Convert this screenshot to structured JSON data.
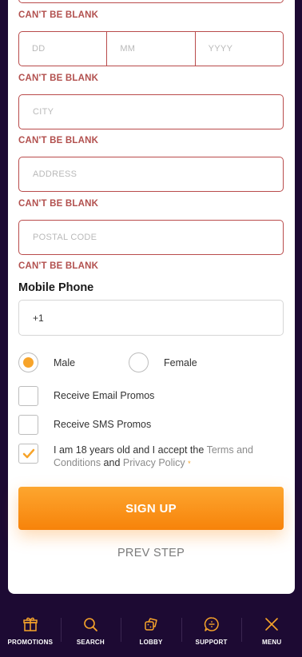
{
  "errors": {
    "cant_be_blank": "CAN'T BE BLANK"
  },
  "dob": {
    "day_placeholder": "DD",
    "month_placeholder": "MM",
    "year_placeholder": "YYYY"
  },
  "city": {
    "placeholder": "CITY"
  },
  "address": {
    "placeholder": "ADDRESS"
  },
  "postal": {
    "placeholder": "POSTAL CODE"
  },
  "mobile": {
    "label": "Mobile Phone",
    "value": "+1"
  },
  "gender": {
    "options": [
      {
        "label": "Male",
        "selected": true
      },
      {
        "label": "Female",
        "selected": false
      }
    ]
  },
  "promos": {
    "email_label": "Receive Email Promos",
    "email_checked": false,
    "sms_label": "Receive SMS Promos",
    "sms_checked": false
  },
  "terms": {
    "text_before": "I am 18 years old and I accept the ",
    "terms_link": "Terms and Conditions",
    "text_and": " and ",
    "privacy_link": "Privacy Policy",
    "required_mark": "*",
    "checked": true
  },
  "buttons": {
    "sign_up": "SIGN UP",
    "prev_step": "PREV STEP"
  },
  "nav": {
    "items": [
      {
        "label": "PROMOTIONS",
        "icon": "gift-icon"
      },
      {
        "label": "SEARCH",
        "icon": "search-icon"
      },
      {
        "label": "LOBBY",
        "icon": "dice-icon"
      },
      {
        "label": "SUPPORT",
        "icon": "support-chat-icon"
      },
      {
        "label": "MENU",
        "icon": "close-icon"
      }
    ]
  },
  "colors": {
    "accent": "#f7a42a",
    "error": "#b2504e",
    "background": "#1d0a33"
  }
}
